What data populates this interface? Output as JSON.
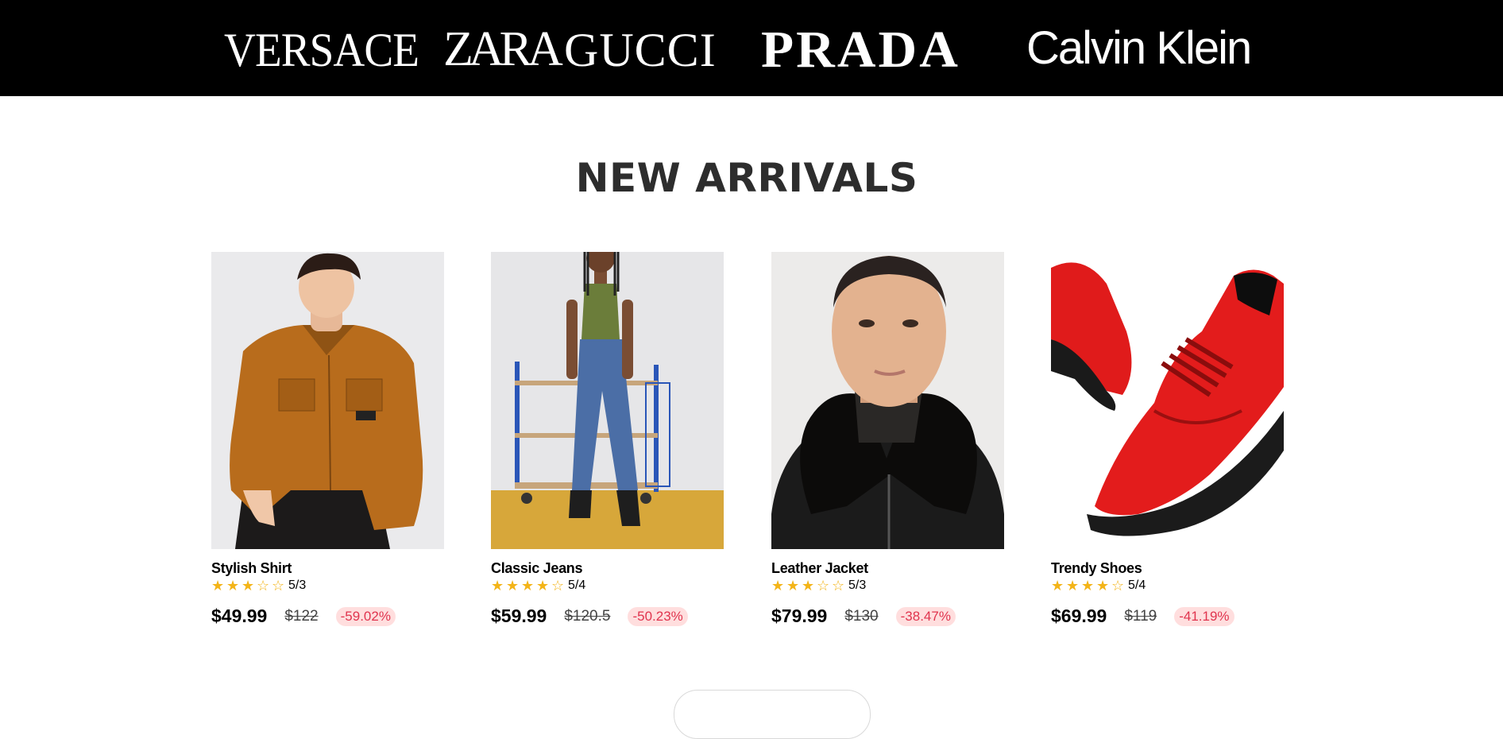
{
  "brands": [
    "VERSACE",
    "ZARA",
    "GUCCI",
    "PRADA",
    "Calvin Klein"
  ],
  "section": {
    "title": "NEW ARRIVALS"
  },
  "products": [
    {
      "name": "Stylish Shirt",
      "rating_text": "5/3",
      "stars_filled": 3,
      "price": "$49.99",
      "old_price": "$122",
      "discount": "-59.02%",
      "image_icon": "model-orange-shirt-photo"
    },
    {
      "name": "Classic Jeans",
      "rating_text": "5/4",
      "stars_filled": 4,
      "price": "$59.99",
      "old_price": "$120.5",
      "discount": "-50.23%",
      "image_icon": "model-denim-jeans-photo"
    },
    {
      "name": "Leather Jacket",
      "rating_text": "5/3",
      "stars_filled": 3,
      "price": "$79.99",
      "old_price": "$130",
      "discount": "-38.47%",
      "image_icon": "model-leather-jacket-photo"
    },
    {
      "name": "Trendy Shoes",
      "rating_text": "5/4",
      "stars_filled": 4,
      "price": "$69.99",
      "old_price": "$119",
      "discount": "-41.19%",
      "image_icon": "red-sneakers-photo"
    }
  ],
  "colors": {
    "star": "#f3b418",
    "discount_text": "#e0344e",
    "discount_bg": "#ffdede",
    "brand_bar": "#000000"
  }
}
